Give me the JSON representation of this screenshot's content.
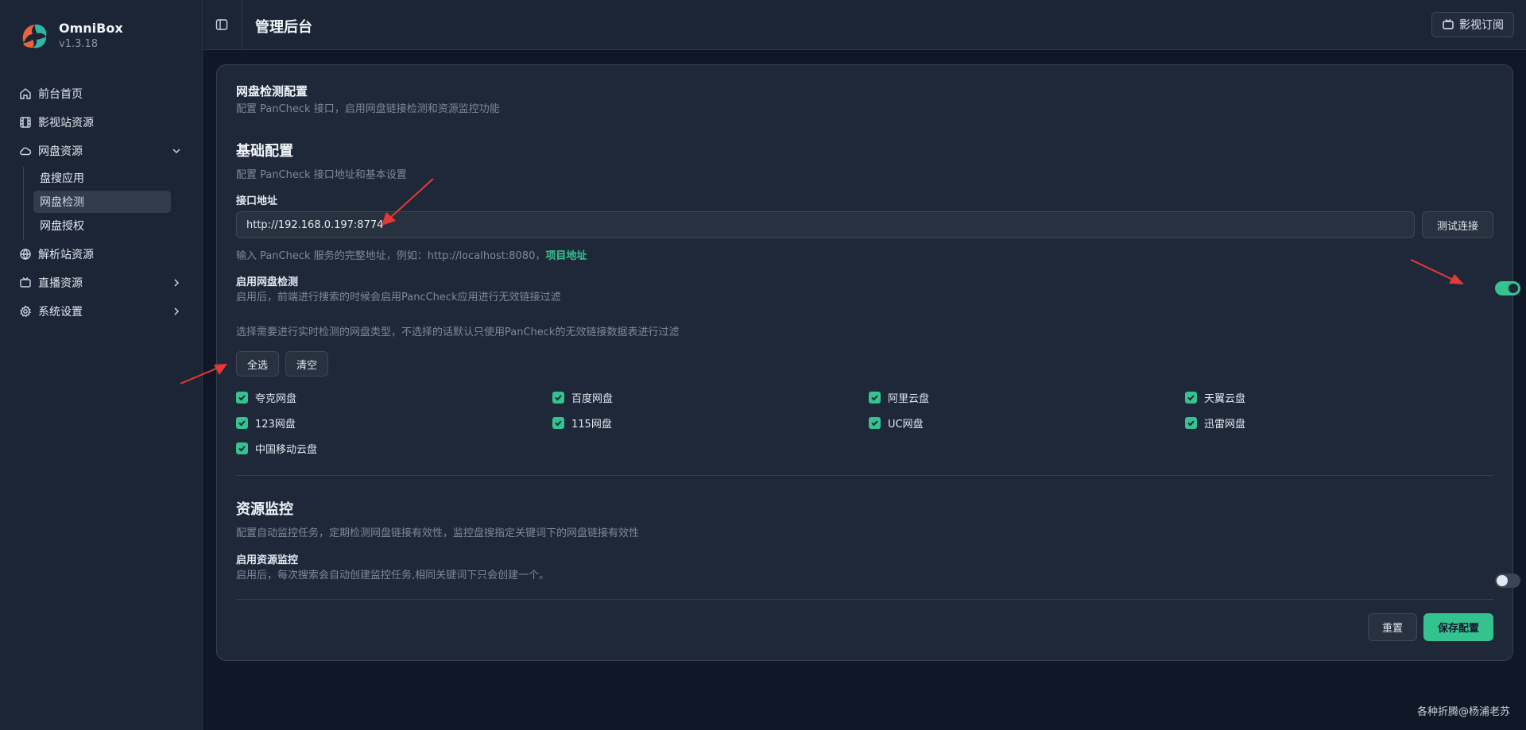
{
  "app": {
    "name": "OmniBox",
    "version": "v1.3.18"
  },
  "sidebar": {
    "items": [
      {
        "label": "前台首页",
        "icon": "home-icon"
      },
      {
        "label": "影视站资源",
        "icon": "film-icon"
      },
      {
        "label": "网盘资源",
        "icon": "cloud-icon",
        "expanded": true,
        "children": [
          {
            "label": "盘搜应用"
          },
          {
            "label": "网盘检测",
            "active": true
          },
          {
            "label": "网盘授权"
          }
        ]
      },
      {
        "label": "解析站资源",
        "icon": "globe-icon"
      },
      {
        "label": "直播资源",
        "icon": "tv-icon"
      },
      {
        "label": "系统设置",
        "icon": "gear-icon"
      }
    ]
  },
  "header": {
    "title": "管理后台",
    "subscribe_label": "影视订阅"
  },
  "main": {
    "section_title": "网盘检测配置",
    "section_desc": "配置 PanCheck 接口，启用网盘链接检测和资源监控功能",
    "basic": {
      "title": "基础配置",
      "desc": "配置 PanCheck 接口地址和基本设置",
      "api_label": "接口地址",
      "api_value": "http://192.168.0.197:8774",
      "test_button": "测试连接",
      "hint": "输入 PanCheck 服务的完整地址，例如：http://localhost:8080，",
      "hint_link": "项目地址",
      "enable_title": "启用网盘检测",
      "enable_desc": "启用后，前端进行搜索的时候会启用PancCheck应用进行无效链接过滤",
      "enable_on": true,
      "select_desc": "选择需要进行实时检测的网盘类型，不选择的话默认只使用PanCheck的无效链接数据表进行过滤",
      "select_all": "全选",
      "clear": "清空",
      "drives": [
        "夸克网盘",
        "百度网盘",
        "阿里云盘",
        "天翼云盘",
        "123网盘",
        "115网盘",
        "UC网盘",
        "迅雷网盘",
        "中国移动云盘"
      ]
    },
    "monitor": {
      "title": "资源监控",
      "desc": "配置自动监控任务，定期检测网盘链接有效性，监控盘搜指定关键词下的网盘链接有效性",
      "enable_title": "启用资源监控",
      "enable_desc": "启用后，每次搜索会自动创建监控任务,相同关键词下只会创建一个。",
      "enable_on": false
    },
    "actions": {
      "reset": "重置",
      "save": "保存配置"
    }
  },
  "footer_note": "各种折腾@杨浦老苏",
  "colors": {
    "accent": "#34c38f",
    "annotation_arrow": "#e53935"
  }
}
